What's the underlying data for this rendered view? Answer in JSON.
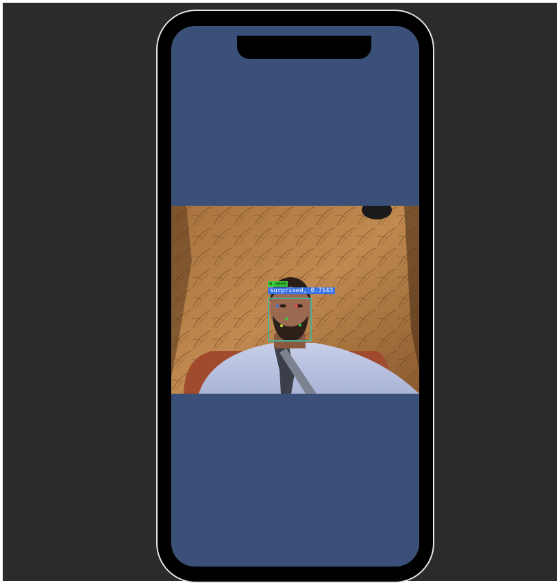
{
  "screen": {
    "background_color": "#3a5078"
  },
  "detection": {
    "score_text": "0.9000",
    "emotion_text": "surprised, 0.7143",
    "box_color": "#4caf9a",
    "score_bg_color": "#3ccf3c",
    "emotion_bg_color": "#3b74e6"
  },
  "icons": {
    "notch": "phone-notch",
    "face_box": "face-bounding-box-icon"
  }
}
